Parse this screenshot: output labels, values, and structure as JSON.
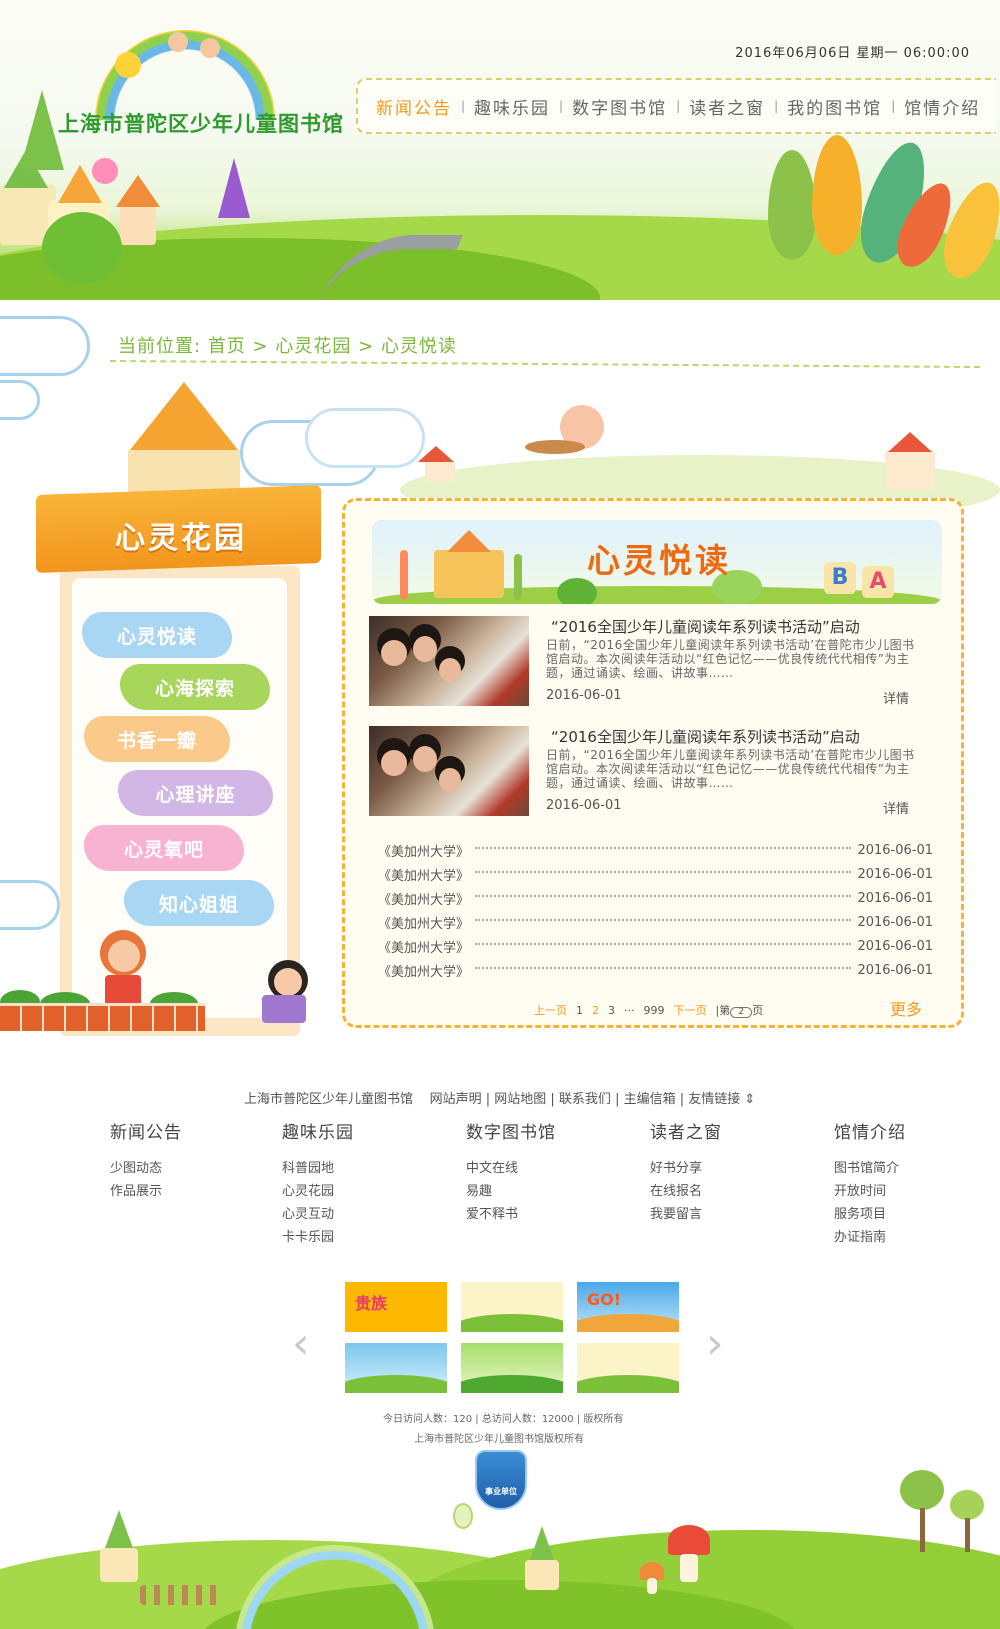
{
  "header": {
    "site_title": "上海市普陀区少年儿童图书馆",
    "datetime": "2016年06月06日  星期一  06:00:00",
    "nav": [
      {
        "label": "新闻公告",
        "active": true
      },
      {
        "label": "趣味乐园",
        "active": false
      },
      {
        "label": "数字图书馆",
        "active": false
      },
      {
        "label": "读者之窗",
        "active": false
      },
      {
        "label": "我的图书馆",
        "active": false
      },
      {
        "label": "馆情介绍",
        "active": false
      }
    ]
  },
  "breadcrumb": {
    "prefix": "当前位置:",
    "home": "首页",
    "sep": ">",
    "section": "心灵花园",
    "current": "心灵悦读"
  },
  "sidebar": {
    "title": "心灵花园",
    "items": [
      {
        "label": "心灵悦读",
        "color": "#a9d6f2"
      },
      {
        "label": "心海探索",
        "color": "#a8d65c"
      },
      {
        "label": "书香一瓣",
        "color": "#fbc98a"
      },
      {
        "label": "心理讲座",
        "color": "#d2b6e6"
      },
      {
        "label": "心灵氧吧",
        "color": "#f8b2d2"
      },
      {
        "label": "知心姐姐",
        "color": "#a9d6f2"
      }
    ]
  },
  "content": {
    "banner_title": "心灵悦读",
    "banner_blocks": [
      "B",
      "A"
    ],
    "features": [
      {
        "title": "“2016全国少年儿童阅读年系列读书活动”启动",
        "desc": "日前，“2016全国少年儿童阅读年系列读书活动’在普陀市少儿图书馆启动。本次阅读年活动以“红色记忆——优良传统代代相传”为主题，通过诵读、绘画、讲故事……",
        "date": "2016-06-01",
        "more": "详情"
      },
      {
        "title": "“2016全国少年儿童阅读年系列读书活动”启动",
        "desc": "日前，“2016全国少年儿童阅读年系列读书活动’在普陀市少儿图书馆启动。本次阅读年活动以“红色记忆——优良传统代代相传”为主题，通过诵读、绘画、讲故事……",
        "date": "2016-06-01",
        "more": "详情"
      }
    ],
    "news": [
      {
        "title": "《美加州大学》",
        "date": "2016-06-01"
      },
      {
        "title": "《美加州大学》",
        "date": "2016-06-01"
      },
      {
        "title": "《美加州大学》",
        "date": "2016-06-01"
      },
      {
        "title": "《美加州大学》",
        "date": "2016-06-01"
      },
      {
        "title": "《美加州大学》",
        "date": "2016-06-01"
      },
      {
        "title": "《美加州大学》",
        "date": "2016-06-01"
      }
    ],
    "pager": {
      "prev": "上一页",
      "pages": [
        "1",
        "2",
        "3"
      ],
      "current_page": "2",
      "ellipsis": "···",
      "last": "999",
      "next": "下一页",
      "goto_prefix": "第",
      "goto_value": "2",
      "goto_suffix": "页"
    },
    "more": "更多"
  },
  "footer": {
    "links": [
      "上海市普陀区少年儿童图书馆",
      "网站声明",
      "网站地图",
      "联系我们",
      "主编信箱",
      "友情链接"
    ],
    "columns": [
      {
        "head": "新闻公告",
        "items": [
          "少图动态",
          "作品展示"
        ]
      },
      {
        "head": "趣味乐园",
        "items": [
          "科普园地",
          "心灵花园",
          "心灵互动",
          "卡卡乐园"
        ]
      },
      {
        "head": "数字图书馆",
        "items": [
          "中文在线",
          "易趣",
          "爱不释书"
        ]
      },
      {
        "head": "读者之窗",
        "items": [
          "好书分享",
          "在线报名",
          "我要留言"
        ]
      },
      {
        "head": "馆情介绍",
        "items": [
          "图书馆简介",
          "开放时间",
          "服务项目",
          "办证指南"
        ]
      }
    ],
    "thumb_texts": [
      "贵族",
      "GO!"
    ],
    "stats": "今日访问人数：120 | 总访问人数：12000 | 版权所有",
    "copyright": "上海市普陀区少年儿童图书馆版权所有",
    "badge": "事业单位"
  },
  "colors": {
    "accent_orange": "#f39a1c",
    "brand_green": "#2f9a2e",
    "breadcrumb_green": "#7ab83a"
  }
}
